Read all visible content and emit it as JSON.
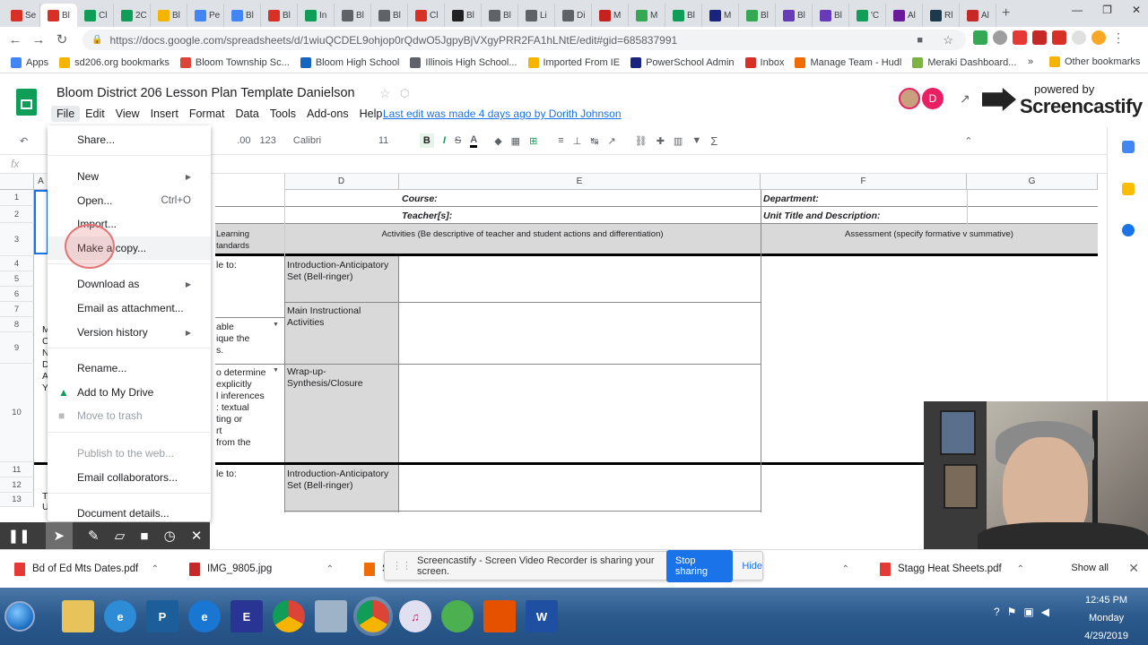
{
  "browser": {
    "url": "https://docs.google.com/spreadsheets/d/1wiuQCDEL9ohjop0rQdwO5JgpyBjVXgyPRR2FA1hLNtE/edit#gid=685837991",
    "tabs": [
      "Se",
      "Bl",
      "Cl",
      "2C",
      "Bl",
      "Pe",
      "Bl",
      "Bl",
      "In",
      "Bl",
      "Bl",
      "Cl",
      "Bl",
      "Bl",
      "Li",
      "Di",
      "M",
      "M",
      "Bl",
      "M",
      "Bl",
      "Bl",
      "Bl",
      "'C",
      "Al",
      "Rl",
      "Al"
    ],
    "tab_colors": [
      "#d93025",
      "#d93025",
      "#0f9d58",
      "#0f9d58",
      "#f4b400",
      "#4285f4",
      "#4285f4",
      "#d93025",
      "#0f9d58",
      "#5f6368",
      "#5f6368",
      "#d93025",
      "#202124",
      "#5f6368",
      "#5f6368",
      "#5f6368",
      "#c5221f",
      "#34a853",
      "#0f9d58",
      "#1a237e",
      "#34a853",
      "#673ab7",
      "#673ab7",
      "#0f9d58",
      "#6a1b9a",
      "#1b3a4b",
      "#c62828",
      "#d93025"
    ],
    "bookmarks": [
      "Apps",
      "sd206.org bookmarks",
      "Bloom Township Sc...",
      "Bloom High School",
      "Illinois High School...",
      "Imported From IE",
      "PowerSchool Admin",
      "Inbox",
      "Manage Team - Hudl",
      "Meraki Dashboard..."
    ],
    "other_bookmarks": "Other bookmarks",
    "chevron": "»"
  },
  "doc": {
    "title": "Bloom District 206 Lesson Plan Template Danielson",
    "menu": [
      "File",
      "Edit",
      "View",
      "Insert",
      "Format",
      "Data",
      "Tools",
      "Add-ons",
      "Help"
    ],
    "last_edit": "Last edit was made 4 days ago by Dorith Johnson",
    "avatar_letter": "D",
    "screencastify_line1": "powered by",
    "screencastify_line2": "Screencastify"
  },
  "toolbar": {
    "decimal": ".00",
    "format": "123",
    "font": "Calibri",
    "size": "11",
    "bold": "B",
    "italic": "I",
    "strike": "S",
    "underline_a": "A"
  },
  "sheet": {
    "columns": [
      "A",
      "D",
      "E",
      "F",
      "G"
    ],
    "rows": [
      "1",
      "2",
      "3",
      "4",
      "5",
      "6",
      "7",
      "8",
      "9",
      "10",
      "11",
      "12",
      "13"
    ],
    "cells": {
      "course": "Course:",
      "department": "Department:",
      "teacher": "Teacher[s]:",
      "unit": "Unit Title and Description:",
      "learning": "Learning",
      "standards": "tandards",
      "activities": "Activities (Be descriptive of teacher and student actions and differentiation)",
      "assessment": "Assessment (specify formative v summative)",
      "intro1": "Introduction-Anticipatory Set (Bell-ringer)",
      "main": "Main Instructional Activities",
      "wrap": "Wrap-up-Synthesis/Closure",
      "intro2": "Introduction-Anticipatory Set (Bell-ringer)",
      "c_le1": "le to:",
      "c_able": "able",
      "c_ique": "ique the",
      "c_s": "s.",
      "c_det": "o determine",
      "c_expl": "explicitly",
      "c_inf": "l inferences",
      "c_text": ": textual",
      "c_ting": "ting or",
      "c_rt": "rt",
      "c_from": "from the",
      "c_le2": "le to:",
      "a_letters": [
        "M",
        "C",
        "N",
        "D",
        "A",
        "Y"
      ],
      "a_t": "T",
      "a_u": "U"
    }
  },
  "file_menu": {
    "share": "Share...",
    "new": "New",
    "open": "Open...",
    "open_shortcut": "Ctrl+O",
    "import": "Import...",
    "make_copy": "Make a copy...",
    "download": "Download as",
    "email_attach": "Email as attachment...",
    "version": "Version history",
    "rename": "Rename...",
    "add_drive": "Add to My Drive",
    "trash": "Move to trash",
    "publish": "Publish to the web...",
    "email_collab": "Email collaborators...",
    "details": "Document details..."
  },
  "sharing_bar": {
    "message": "Screencastify - Screen Video Recorder is sharing your screen.",
    "stop": "Stop sharing",
    "hide": "Hide"
  },
  "downloads": {
    "items": [
      "Bd of Ed Mts Dates.pdf",
      "IMG_9805.jpg",
      "St",
      "Stagg Heat Sheets.pdf"
    ],
    "partial_jpg": "jpg",
    "show_all": "Show all"
  },
  "taskbar": {
    "time": "12:45 PM",
    "day": "Monday",
    "date": "4/29/2019"
  }
}
